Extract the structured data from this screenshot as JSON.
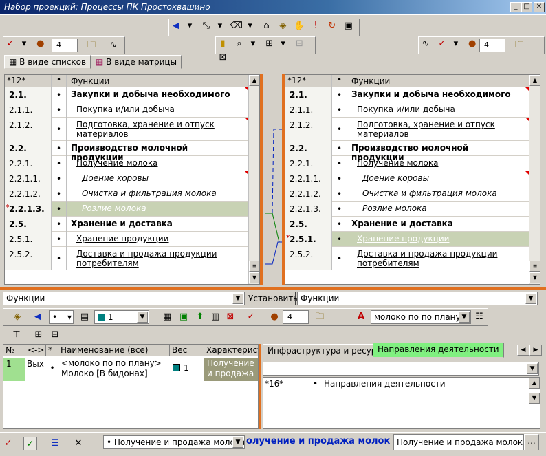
{
  "window": {
    "title": "Набор проекций: Процессы ПК Простоквашино",
    "min": "_",
    "max": "□",
    "close": "✕"
  },
  "tabs": [
    "В виде списков",
    "В виде матрицы"
  ],
  "spin_value": "4",
  "left_grid": {
    "header": {
      "num": "*12*",
      "dot": "•",
      "fn": "Функции"
    },
    "rows": [
      {
        "num": "2.1.",
        "fn": "Закупки и добыча необходимого"
      },
      {
        "num": "2.1.1.",
        "fn": "Покупка и/или добыча"
      },
      {
        "num": "2.1.2.",
        "fn": "Подготовка, хранение и отпуск материалов"
      },
      {
        "num": "2.2.",
        "fn": "Производство молочной продукции"
      },
      {
        "num": "2.2.1.",
        "fn": "Получение молока"
      },
      {
        "num": "2.2.1.1.",
        "fn": "Доение коровы"
      },
      {
        "num": "2.2.1.2.",
        "fn": "Очистка и фильтрация молока"
      },
      {
        "num": "2.2.1.3.",
        "fn": "Розлие молока",
        "mark": "*"
      },
      {
        "num": "2.5.",
        "fn": "Хранение и доставка"
      },
      {
        "num": "2.5.1.",
        "fn": "Хранение продукции"
      },
      {
        "num": "2.5.2.",
        "fn": "Доставка и продажа продукции потребителям"
      }
    ]
  },
  "right_grid": {
    "header": {
      "num": "*12*",
      "dot": "•",
      "fn": "Функции"
    },
    "rows": [
      {
        "num": "2.1.",
        "fn": "Закупки и добыча необходимого"
      },
      {
        "num": "2.1.1.",
        "fn": "Покупка и/или добыча"
      },
      {
        "num": "2.1.2.",
        "fn": "Подготовка, хранение и отпуск материалов"
      },
      {
        "num": "2.2.",
        "fn": "Производство молочной продукции"
      },
      {
        "num": "2.2.1.",
        "fn": "Получение молока"
      },
      {
        "num": "2.2.1.1.",
        "fn": "Доение коровы"
      },
      {
        "num": "2.2.1.2.",
        "fn": "Очистка и фильтрация молока"
      },
      {
        "num": "2.2.1.3.",
        "fn": "Розлие молока"
      },
      {
        "num": "2.5.",
        "fn": "Хранение и доставка"
      },
      {
        "num": "2.5.1.",
        "fn": "Хранение продукции",
        "mark": "*"
      },
      {
        "num": "2.5.2.",
        "fn": "Доставка и продажа продукции потребителям"
      }
    ]
  },
  "combo_left": "Функции",
  "set_button": "Установить",
  "combo_right": "Функции",
  "toolbar2": {
    "dot_combo": "•",
    "color_combo": "1",
    "spin": "4",
    "text_combo": "молоко по по плану"
  },
  "bottom_table": {
    "headers": [
      "№",
      "<->",
      "*",
      "Наименование (все)",
      "Вес",
      "Характеристи"
    ],
    "row": {
      "num": "1",
      "dir": "Вых",
      "dot": "•",
      "name": "<молоко по по плану> Молоко [В бидонах]",
      "weight": "1",
      "char": "Получение и продажа молока"
    }
  },
  "right_tabs": [
    "Инфраструктура и ресурсы",
    "Направления деятельности"
  ],
  "right_mini_grid": {
    "num": "*16*",
    "dot": "•",
    "fn": "Направления деятельности"
  },
  "status": {
    "combo": "Получение и продажа молока",
    "marquee": "олучение и продажа молок",
    "field": "Получение и продажа молока",
    "dots": "..."
  }
}
